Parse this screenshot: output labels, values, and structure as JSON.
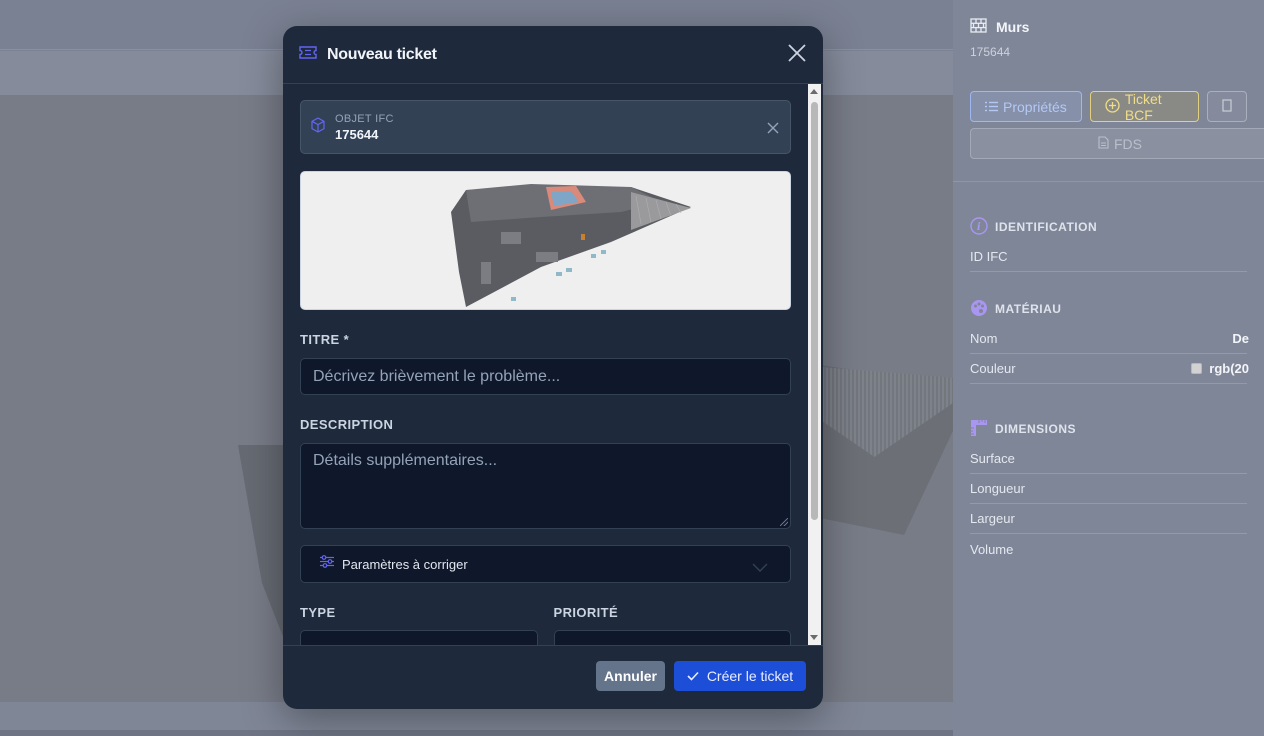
{
  "modal": {
    "title": "Nouveau ticket",
    "ifc_object": {
      "label": "OBJET IFC",
      "value": "175644"
    },
    "title_field": {
      "label": "TITRE *",
      "placeholder": "Décrivez brièvement le problème..."
    },
    "description_field": {
      "label": "DESCRIPTION",
      "placeholder": "Détails supplémentaires..."
    },
    "params_section": "Paramètres à corriger",
    "type_field": {
      "label": "TYPE"
    },
    "priority_field": {
      "label": "PRIORITÉ"
    },
    "cancel_label": "Annuler",
    "create_label": "Créer le ticket"
  },
  "side_panel": {
    "element_name": "Murs",
    "element_id": "175644",
    "buttons": {
      "properties": "Propriétés",
      "bcf": "Ticket BCF",
      "fds": "FDS"
    },
    "identification": {
      "title": "IDENTIFICATION",
      "rows": [
        {
          "label": "ID IFC",
          "value": ""
        }
      ]
    },
    "material": {
      "title": "MATÉRIAU",
      "rows": [
        {
          "label": "Nom",
          "value": "De"
        },
        {
          "label": "Couleur",
          "value": "rgb(20"
        }
      ]
    },
    "dimensions": {
      "title": "DIMENSIONS",
      "rows": [
        {
          "label": "Surface",
          "value": ""
        },
        {
          "label": "Longueur",
          "value": ""
        },
        {
          "label": "Largeur",
          "value": ""
        },
        {
          "label": "Volume",
          "value": ""
        }
      ]
    }
  },
  "colors": {
    "accent_blue": "#1d4ed8",
    "modal_bg": "#1e293b",
    "input_bg": "#0f172a",
    "bcf_yellow": "#f0dd8a",
    "icon_purple": "#8b5cf6"
  }
}
